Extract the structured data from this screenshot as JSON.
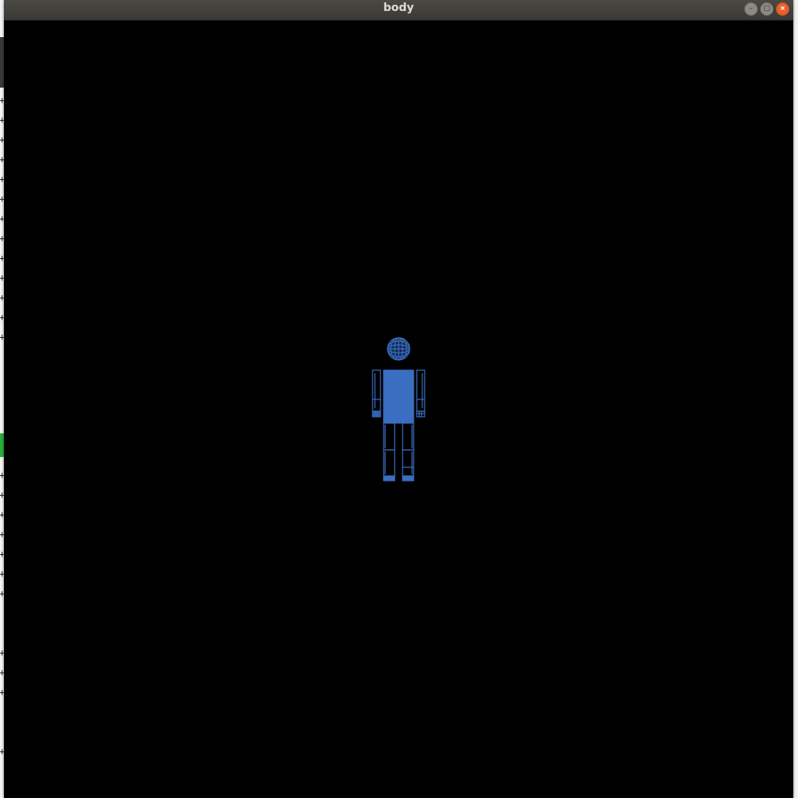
{
  "window": {
    "title": "body",
    "minimize_glyph": "–",
    "maximize_glyph": "□",
    "close_glyph": "×"
  },
  "background_window": {
    "edge_marks": [
      "+",
      "+",
      "+",
      "+",
      "+",
      "+",
      "+",
      "+",
      "+",
      "+",
      "+",
      "+",
      "+",
      "+",
      "+",
      "+",
      "+",
      "+",
      "+",
      "+",
      "+",
      "+",
      "+",
      "+"
    ]
  },
  "scene": {
    "background_color": "#000000",
    "body_color": "#3a6ec0",
    "parts": [
      "head",
      "torso",
      "left-upper-arm",
      "right-upper-arm",
      "left-hand",
      "right-hand",
      "left-thigh",
      "right-thigh",
      "left-shin",
      "right-shin",
      "left-foot",
      "right-foot"
    ]
  }
}
